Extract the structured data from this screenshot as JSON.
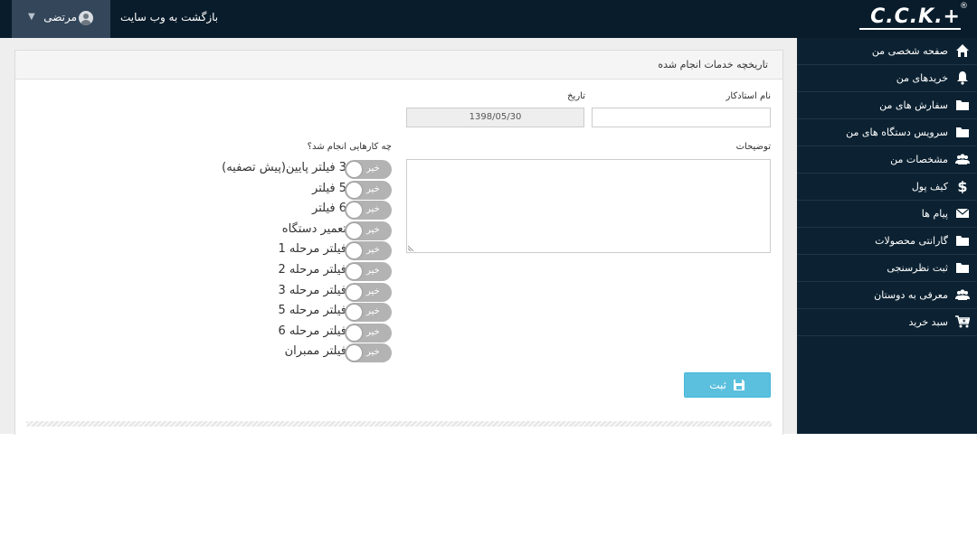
{
  "header": {
    "logo_text": "C.C.K.+",
    "logo_mark": "®",
    "back_link": "بازگشت به وب سایت",
    "user_name": "مرتضی",
    "user_avatar_icon": "user-avatar-icon",
    "chevron_icon": "chevron-down-icon"
  },
  "sidebar": {
    "items": [
      {
        "label": "صفحه شخصی من",
        "icon": "home-icon"
      },
      {
        "label": "خریدهای من",
        "icon": "bell-icon"
      },
      {
        "label": "سفارش های من",
        "icon": "folder-icon"
      },
      {
        "label": "سرویس دستگاه های من",
        "icon": "folder-icon"
      },
      {
        "label": "مشخصات من",
        "icon": "users-icon"
      },
      {
        "label": "کیف پول",
        "icon": "dollar-icon"
      },
      {
        "label": "پیام ها",
        "icon": "envelope-icon"
      },
      {
        "label": "گارانتی محصولات",
        "icon": "folder-icon"
      },
      {
        "label": "ثبت نظرسنجی",
        "icon": "folder-icon"
      },
      {
        "label": "معرفی به دوستان",
        "icon": "users-icon"
      },
      {
        "label": "سبد خرید",
        "icon": "cart-icon"
      }
    ]
  },
  "panel": {
    "title": "تاریخچه خدمات انجام شده"
  },
  "form": {
    "technician_label": "نام استادکار",
    "technician_value": "",
    "date_label": "تاریخ",
    "date_value": "1398/05/30",
    "description_label": "توضیحات",
    "description_value": "",
    "tasks_label": "چه کارهایی انجام شد؟",
    "switch_off_text": "خیر",
    "tasks": [
      {
        "label": "3 فیلتر پایین(پیش تصفیه)",
        "checked": false
      },
      {
        "label": "5 فیلتر",
        "checked": false
      },
      {
        "label": "6 فیلتر",
        "checked": false
      },
      {
        "label": "تعمیر دستگاه",
        "checked": false
      },
      {
        "label": "فیلتر مرحله 1",
        "checked": false
      },
      {
        "label": "فیلتر مرحله 2",
        "checked": false
      },
      {
        "label": "فیلتر مرحله 3",
        "checked": false
      },
      {
        "label": "فیلتر مرحله 5",
        "checked": false
      },
      {
        "label": "فیلتر مرحله 6",
        "checked": false
      },
      {
        "label": "فیلتر ممبران",
        "checked": false
      }
    ],
    "save_label": "ثبت",
    "save_icon": "floppy-disk-icon"
  },
  "colors": {
    "topbar": "#091c2b",
    "sidebar": "#0c2232",
    "button": "#5bc0de",
    "switch_off": "#b3b3b3"
  }
}
